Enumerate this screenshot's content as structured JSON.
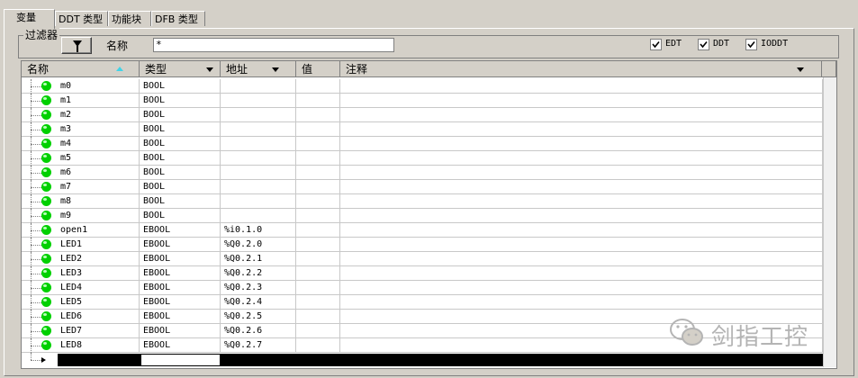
{
  "tabs": [
    {
      "label": "变量"
    },
    {
      "label": "DDT 类型"
    },
    {
      "label": "功能块"
    },
    {
      "label": "DFB 类型"
    }
  ],
  "filter": {
    "group_title": "过滤器",
    "name_label": "名称",
    "name_value": "*",
    "checkboxes": [
      {
        "label": "EDT",
        "checked": true
      },
      {
        "label": "DDT",
        "checked": true
      },
      {
        "label": "IODDT",
        "checked": true
      }
    ]
  },
  "columns": [
    {
      "label": "名称"
    },
    {
      "label": "类型"
    },
    {
      "label": "地址"
    },
    {
      "label": "值"
    },
    {
      "label": "注释"
    }
  ],
  "rows": [
    {
      "name": "m0",
      "type": "BOOL",
      "address": ""
    },
    {
      "name": "m1",
      "type": "BOOL",
      "address": ""
    },
    {
      "name": "m2",
      "type": "BOOL",
      "address": ""
    },
    {
      "name": "m3",
      "type": "BOOL",
      "address": ""
    },
    {
      "name": "m4",
      "type": "BOOL",
      "address": ""
    },
    {
      "name": "m5",
      "type": "BOOL",
      "address": ""
    },
    {
      "name": "m6",
      "type": "BOOL",
      "address": ""
    },
    {
      "name": "m7",
      "type": "BOOL",
      "address": ""
    },
    {
      "name": "m8",
      "type": "BOOL",
      "address": ""
    },
    {
      "name": "m9",
      "type": "BOOL",
      "address": ""
    },
    {
      "name": "open1",
      "type": "EBOOL",
      "address": "%i0.1.0"
    },
    {
      "name": "LED1",
      "type": "EBOOL",
      "address": "%Q0.2.0"
    },
    {
      "name": "LED2",
      "type": "EBOOL",
      "address": "%Q0.2.1"
    },
    {
      "name": "LED3",
      "type": "EBOOL",
      "address": "%Q0.2.2"
    },
    {
      "name": "LED4",
      "type": "EBOOL",
      "address": "%Q0.2.3"
    },
    {
      "name": "LED5",
      "type": "EBOOL",
      "address": "%Q0.2.4"
    },
    {
      "name": "LED6",
      "type": "EBOOL",
      "address": "%Q0.2.5"
    },
    {
      "name": "LED7",
      "type": "EBOOL",
      "address": "%Q0.2.6"
    },
    {
      "name": "LED8",
      "type": "EBOOL",
      "address": "%Q0.2.7"
    }
  ],
  "watermark": {
    "text": "剑指工控"
  },
  "colors": {
    "status_dot": "#00d000",
    "sort_arrow": "#3fd4e8"
  }
}
